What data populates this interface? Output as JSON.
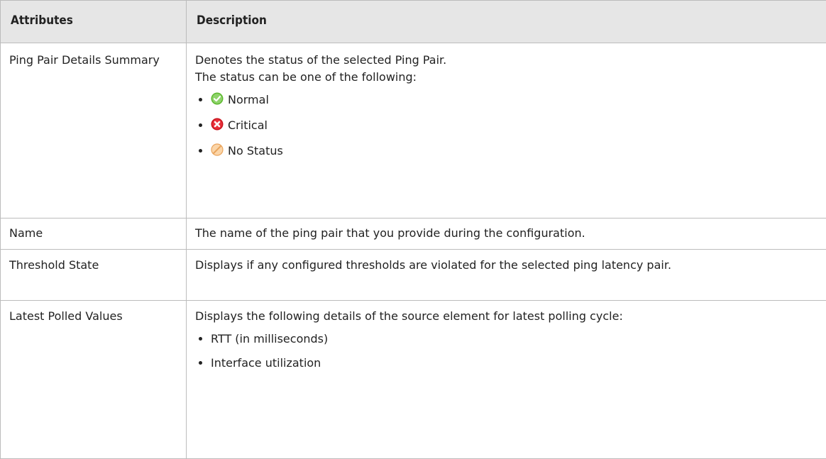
{
  "table": {
    "headers": {
      "attributes": "Attributes",
      "description": "Description"
    },
    "rows": {
      "summary": {
        "attribute": "Ping Pair Details Summary",
        "description_line1": "Denotes the status of the selected Ping Pair.",
        "description_line2": "The status can be one of the following:",
        "statuses": [
          {
            "label": "Normal",
            "icon": "normal-status-icon",
            "color": "#5cb82e"
          },
          {
            "label": "Critical",
            "icon": "critical-status-icon",
            "color": "#e0202a"
          },
          {
            "label": "No Status",
            "icon": "no-status-icon",
            "color": "#f2b36b"
          }
        ]
      },
      "name": {
        "attribute": "Name",
        "description": "The name of the ping pair that you provide during the configuration."
      },
      "threshold": {
        "attribute": "Threshold State",
        "description": "Displays if any configured thresholds are violated for the selected ping latency pair."
      },
      "latest": {
        "attribute": "Latest Polled Values",
        "description": "Displays the following details of the source element for latest polling cycle:",
        "items": [
          "RTT (in milliseconds)",
          "Interface utilization"
        ]
      }
    }
  }
}
